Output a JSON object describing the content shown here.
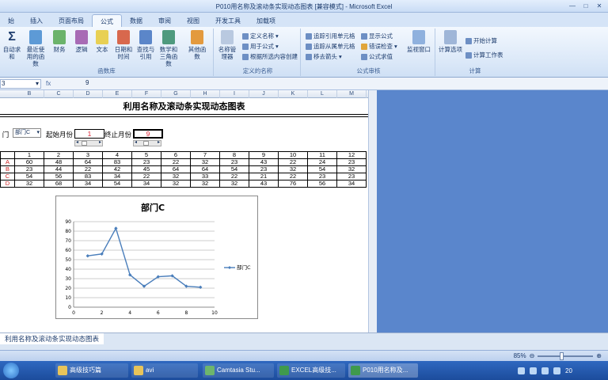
{
  "window": {
    "title": "P010用名称及滚动条实现动态图表 [兼容模式] - Microsoft Excel"
  },
  "ribbon_tabs": [
    "始",
    "插入",
    "页面布局",
    "公式",
    "数据",
    "审阅",
    "视图",
    "开发工具",
    "加载项"
  ],
  "ribbon": {
    "library": {
      "label": "函数库",
      "buttons": [
        {
          "label": "自动求和",
          "icon": "sigma-icon"
        },
        {
          "label": "最近使用的函数",
          "icon": "book-icon"
        },
        {
          "label": "财务",
          "icon": "book-icon"
        },
        {
          "label": "逻辑",
          "icon": "book-icon"
        },
        {
          "label": "文本",
          "icon": "book-icon"
        },
        {
          "label": "日期和时间",
          "icon": "book-icon"
        },
        {
          "label": "查找与引用",
          "icon": "book-icon"
        },
        {
          "label": "数学和三角函数",
          "icon": "book-icon"
        },
        {
          "label": "其他函数",
          "icon": "book-icon"
        }
      ]
    },
    "names": {
      "label": "定义的名称",
      "manager": "名称管理器",
      "items": [
        "定义名称",
        "用于公式",
        "根据所选内容创建"
      ]
    },
    "audit": {
      "label": "公式审核",
      "items": [
        "追踪引用单元格",
        "追踪从属单元格",
        "移去箭头",
        "显示公式",
        "错误检查",
        "公式求值"
      ],
      "watch": "监视窗口"
    },
    "calc": {
      "label": "计算",
      "options": "计算选项",
      "items": [
        "开始计算",
        "计算工作表"
      ]
    }
  },
  "formula_bar": {
    "name_box": "3",
    "fx": "fx",
    "value": "9"
  },
  "sheet": {
    "columns": [
      "B",
      "C",
      "D",
      "E",
      "F",
      "G",
      "H",
      "I",
      "J",
      "K",
      "L",
      "M"
    ],
    "title": "利用名称及滚动条实现动态图表",
    "dept_label": "门",
    "dept_select": "部门C",
    "start_label": "起始月份",
    "start_value": "1",
    "end_label": "终止月份",
    "end_value": "9",
    "table": {
      "header_row": [
        "",
        "1",
        "2",
        "3",
        "4",
        "5",
        "6",
        "7",
        "8",
        "9",
        "10",
        "11",
        "12"
      ],
      "rows": [
        [
          "A",
          "60",
          "48",
          "64",
          "83",
          "23",
          "22",
          "32",
          "23",
          "43",
          "22",
          "24",
          "23"
        ],
        [
          "B",
          "23",
          "44",
          "22",
          "42",
          "45",
          "64",
          "64",
          "54",
          "23",
          "32",
          "54",
          "32"
        ],
        [
          "C",
          "54",
          "56",
          "83",
          "34",
          "22",
          "32",
          "33",
          "22",
          "21",
          "22",
          "23",
          "23"
        ],
        [
          "D",
          "32",
          "68",
          "34",
          "54",
          "34",
          "32",
          "32",
          "32",
          "43",
          "76",
          "56",
          "34"
        ]
      ]
    },
    "tab_name": "利用名称及滚动条实现动态图表"
  },
  "chart_data": {
    "type": "line",
    "title": "部门C",
    "series": [
      {
        "name": "部门C",
        "x": [
          1,
          2,
          3,
          4,
          5,
          6,
          7,
          8,
          9
        ],
        "values": [
          54,
          56,
          83,
          34,
          22,
          32,
          33,
          22,
          21
        ]
      }
    ],
    "xlim": [
      0,
      10
    ],
    "ylim": [
      0,
      90
    ],
    "xticks": [
      0,
      2,
      4,
      6,
      8,
      10
    ],
    "yticks": [
      0,
      10,
      20,
      30,
      40,
      50,
      60,
      70,
      80,
      90
    ],
    "grid": true,
    "legend": "right",
    "color": "#4a7ebb"
  },
  "status": {
    "zoom": "85%"
  },
  "taskbar": {
    "items": [
      "高级技巧篇",
      "avi",
      "Camtasia Stu...",
      "EXCEL高级技...",
      "P010用名称及..."
    ],
    "clock": "20"
  }
}
